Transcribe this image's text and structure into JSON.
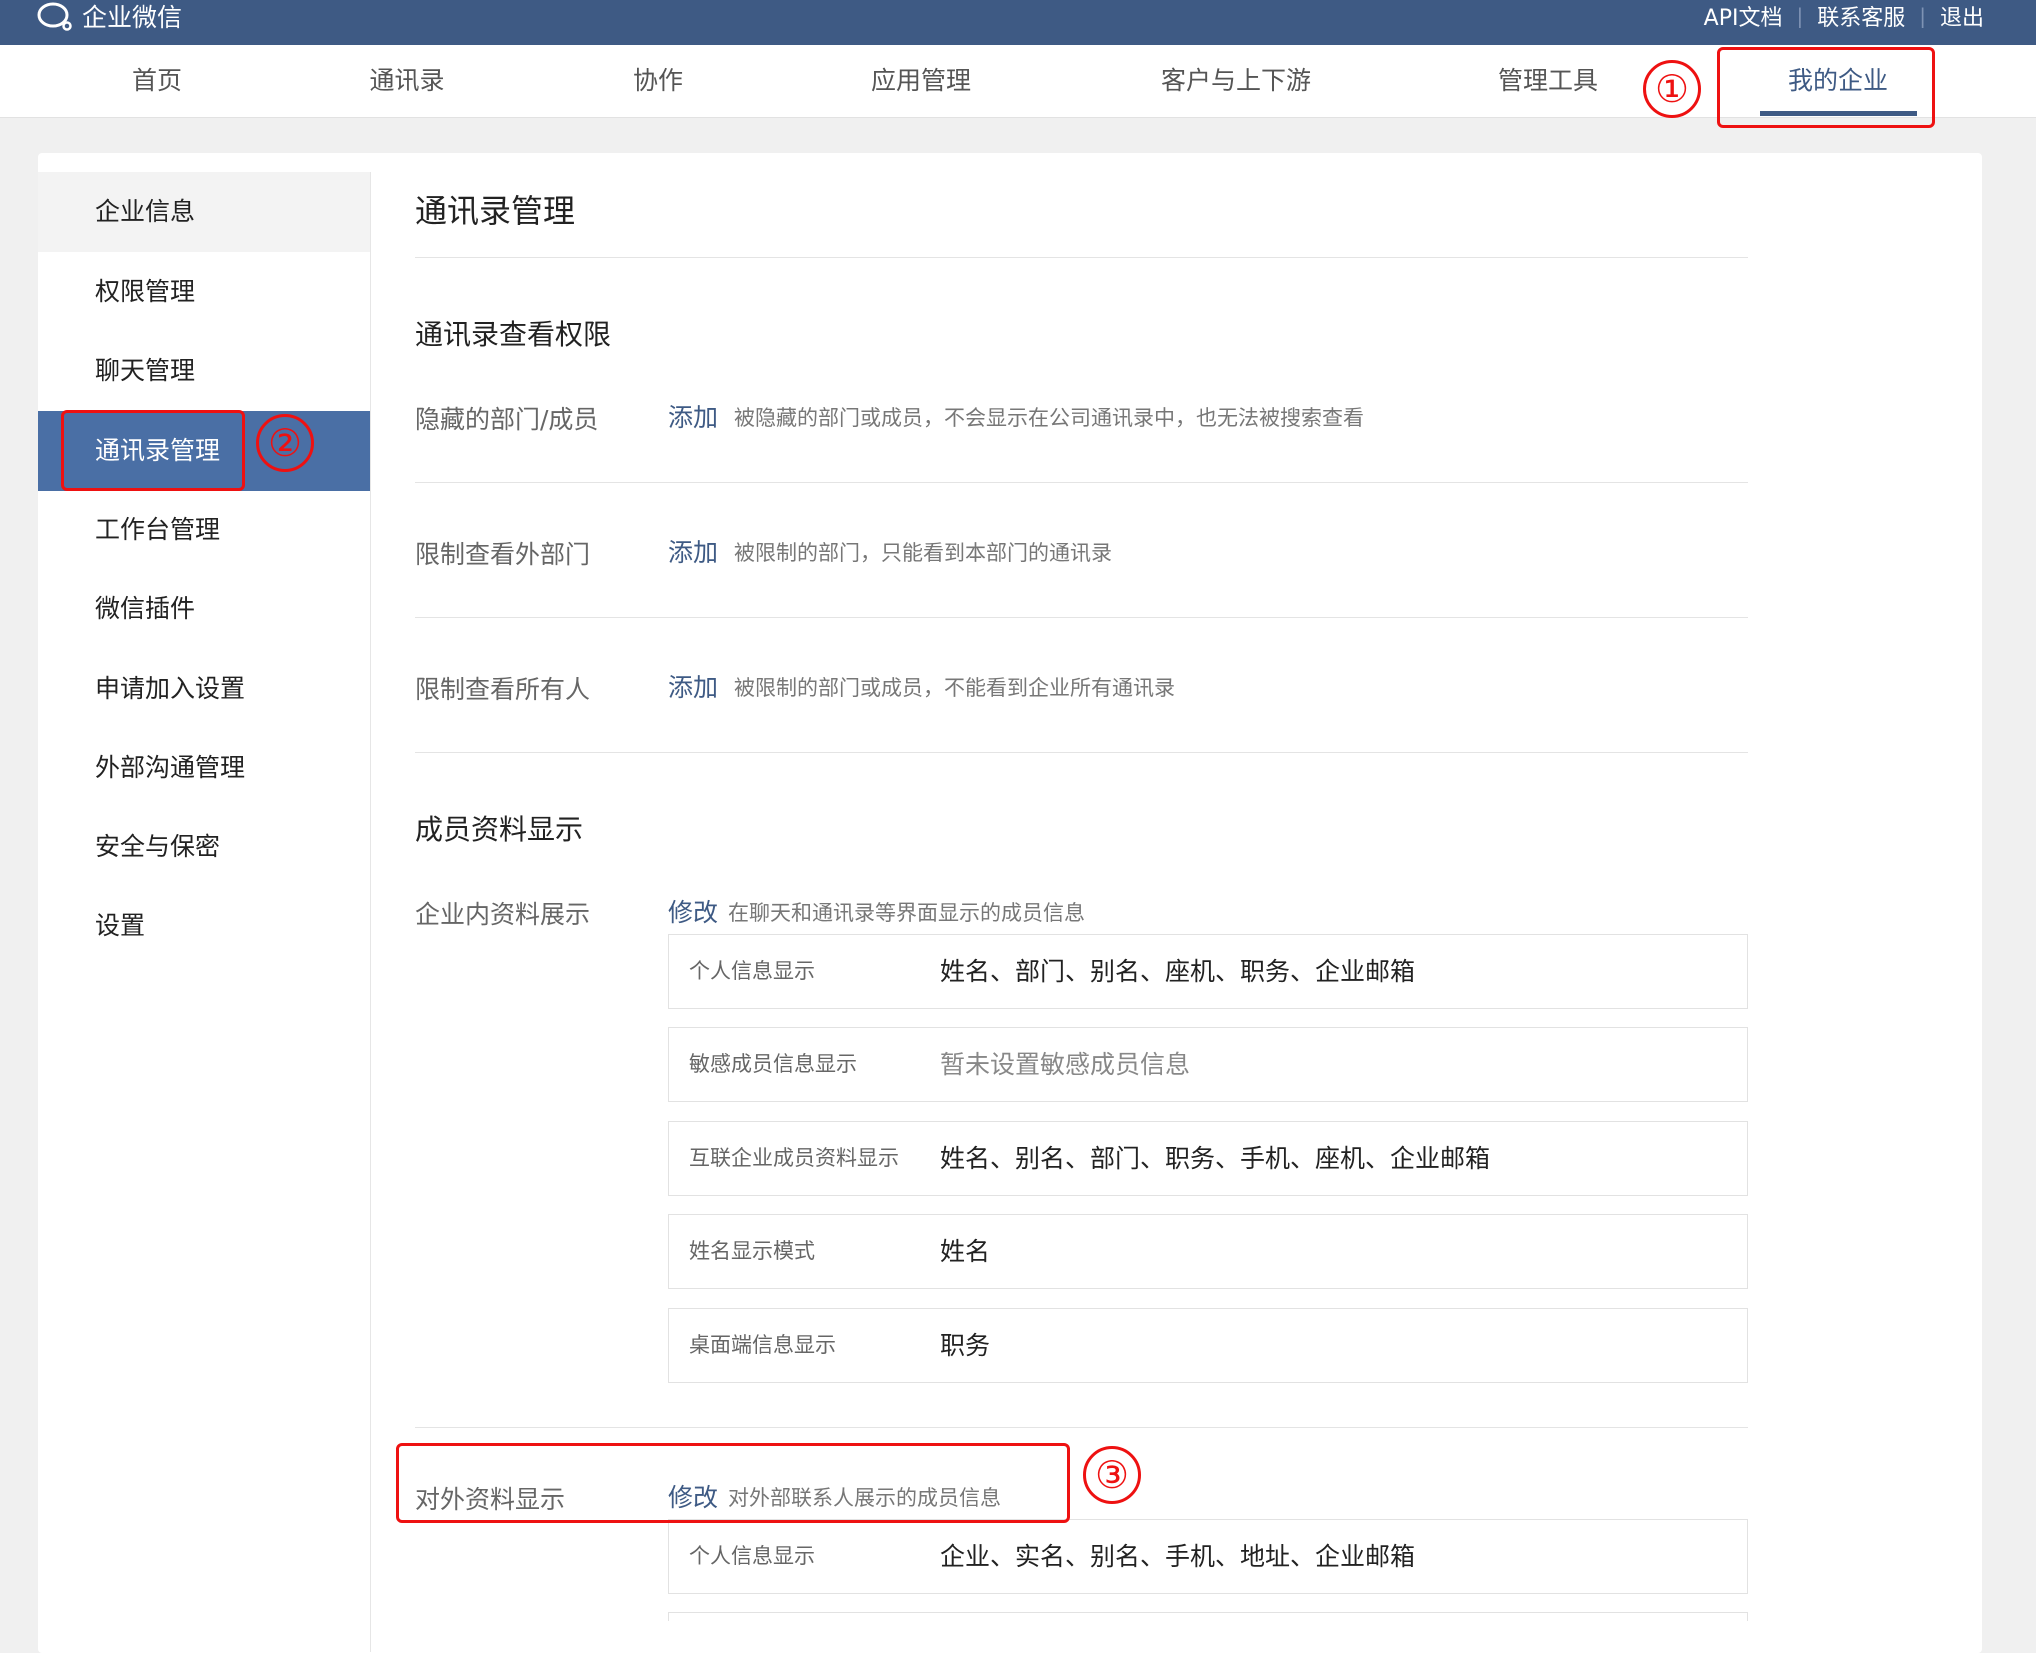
{
  "app": {
    "brand": "企业微信"
  },
  "top_links": [
    {
      "label": "API文档"
    },
    {
      "label": "联系客服"
    },
    {
      "label": "退出"
    }
  ],
  "nav": [
    {
      "label": "首页"
    },
    {
      "label": "通讯录"
    },
    {
      "label": "协作"
    },
    {
      "label": "应用管理"
    },
    {
      "label": "客户与上下游"
    },
    {
      "label": "管理工具"
    },
    {
      "label": "我的企业",
      "active": true
    }
  ],
  "sidebar": [
    {
      "label": "企业信息"
    },
    {
      "label": "权限管理"
    },
    {
      "label": "聊天管理"
    },
    {
      "label": "通讯录管理",
      "active": true
    },
    {
      "label": "工作台管理"
    },
    {
      "label": "微信插件"
    },
    {
      "label": "申请加入设置"
    },
    {
      "label": "外部沟通管理"
    },
    {
      "label": "安全与保密"
    },
    {
      "label": "设置"
    }
  ],
  "annotations": [
    "①",
    "②",
    "③"
  ],
  "main": {
    "title": "通讯录管理",
    "view_permissions": {
      "heading": "通讯录查看权限",
      "rows": [
        {
          "label": "隐藏的部门/成员",
          "link": "添加",
          "desc": "被隐藏的部门或成员，不会显示在公司通讯录中，也无法被搜索查看"
        },
        {
          "label": "限制查看外部门",
          "link": "添加",
          "desc": "被限制的部门，只能看到本部门的通讯录"
        },
        {
          "label": "限制查看所有人",
          "link": "添加",
          "desc": "被限制的部门或成员，不能看到企业所有通讯录"
        }
      ]
    },
    "member_display": {
      "heading": "成员资料显示",
      "internal": {
        "label": "企业内资料展示",
        "link": "修改",
        "desc": "在聊天和通讯录等界面显示的成员信息",
        "items": [
          {
            "key": "个人信息显示",
            "value": "姓名、部门、别名、座机、职务、企业邮箱"
          },
          {
            "key": "敏感成员信息显示",
            "value": "暂未设置敏感成员信息"
          },
          {
            "key": "互联企业成员资料显示",
            "value": "姓名、别名、部门、职务、手机、座机、企业邮箱"
          },
          {
            "key": "姓名显示模式",
            "value": "姓名"
          },
          {
            "key": "桌面端信息显示",
            "value": "职务"
          }
        ]
      },
      "external": {
        "label": "对外资料显示",
        "link": "修改",
        "desc": "对外部联系人展示的成员信息",
        "items": [
          {
            "key": "个人信息显示",
            "value": "企业、实名、别名、手机、地址、企业邮箱"
          }
        ]
      }
    }
  }
}
